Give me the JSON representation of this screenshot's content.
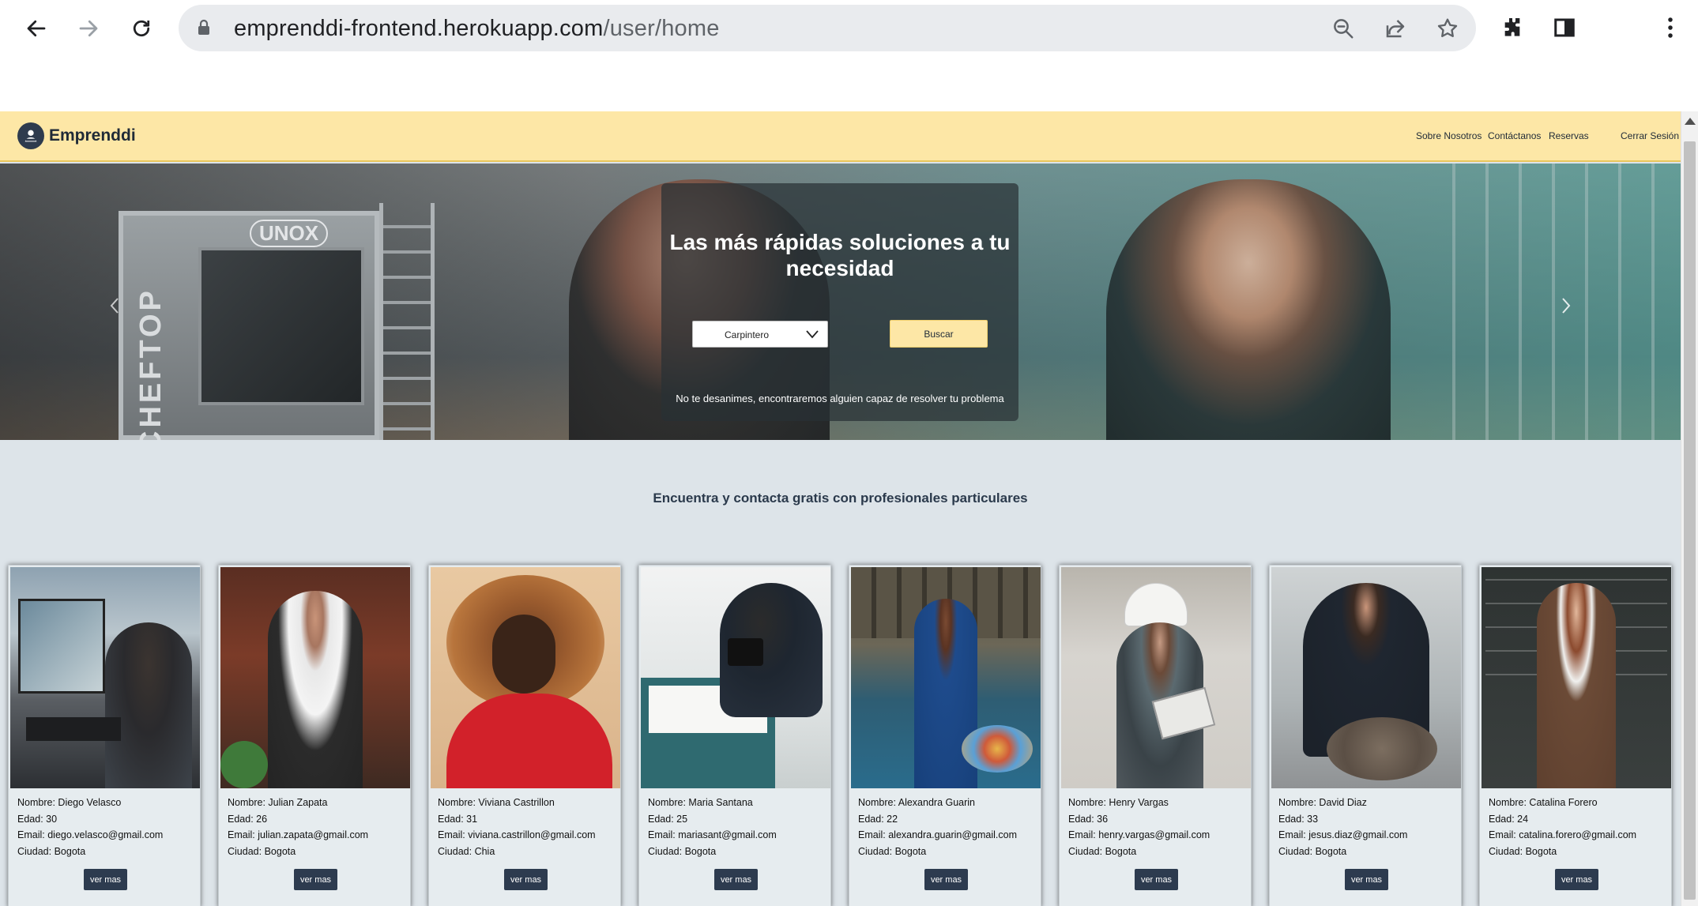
{
  "browser": {
    "url_host": "emprenddi-frontend.herokuapp.com",
    "url_path": "/user/home"
  },
  "site": {
    "brand": "Emprenddi",
    "nav": {
      "about": "Sobre Nosotros",
      "contact": "Contáctanos",
      "bookings": "Reservas",
      "logout": "Cerrar Sesión"
    }
  },
  "hero": {
    "title": "Las más rápidas soluciones a tu necesidad",
    "select_value": "Carpintero",
    "search_label": "Buscar",
    "subtitle": "No te desanimes, encontraremos alguien capaz de resolver tu problema",
    "oven_brand": "UNOX",
    "oven_side": "CHEFTOP"
  },
  "section": {
    "heading": "Encuentra y contacta gratis con profesionales particulares"
  },
  "labels": {
    "name": "Nombre:",
    "age": "Edad:",
    "email": "Email:",
    "city": "Ciudad:",
    "more": "ver mas"
  },
  "profiles": [
    {
      "name": "Diego Velasco",
      "age": "30",
      "email": "diego.velasco@gmail.com",
      "city": "Bogota"
    },
    {
      "name": "Julian Zapata",
      "age": "26",
      "email": "julian.zapata@gmail.com",
      "city": "Bogota"
    },
    {
      "name": "Viviana Castrillon",
      "age": "31",
      "email": "viviana.castrillon@gmail.com",
      "city": "Chia"
    },
    {
      "name": "Maria Santana",
      "age": "25",
      "email": "mariasant@gmail.com",
      "city": "Bogota"
    },
    {
      "name": "Alexandra Guarin",
      "age": "22",
      "email": "alexandra.guarin@gmail.com",
      "city": "Bogota"
    },
    {
      "name": "Henry Vargas",
      "age": "36",
      "email": "henry.vargas@gmail.com",
      "city": "Bogota"
    },
    {
      "name": "David Diaz",
      "age": "33",
      "email": "jesus.diaz@gmail.com",
      "city": "Bogota"
    },
    {
      "name": "Catalina Forero",
      "age": "24",
      "email": "catalina.forero@gmail.com",
      "city": "Bogota"
    }
  ],
  "colors": {
    "header_bg": "#fde7a6",
    "button_dark": "#2d3b4f",
    "page_bg": "#dde4e9"
  }
}
